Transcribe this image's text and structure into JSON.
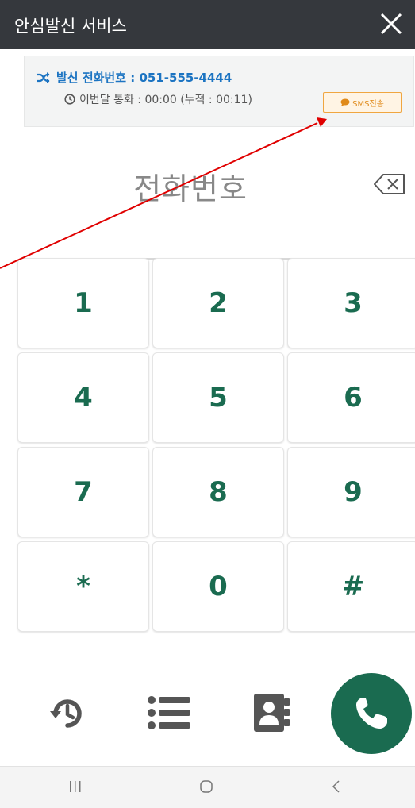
{
  "header": {
    "title": "안심발신 서비스",
    "close_icon": "close-icon"
  },
  "info": {
    "caller_label": "발신 전화번호 : 051-555-4444",
    "usage_label": "이번달 통화 : 00:00 (누적 : 00:11)",
    "sms_button": "SMS전송"
  },
  "dial": {
    "placeholder": "전화번호"
  },
  "keypad": {
    "keys": [
      "1",
      "2",
      "3",
      "4",
      "5",
      "6",
      "7",
      "8",
      "9",
      "*",
      "0",
      "#"
    ]
  },
  "colors": {
    "titlebar": "#35383d",
    "accent_green": "#1a6b50",
    "caller_blue": "#1c74c2",
    "sms_orange": "#f0a640",
    "annotation_red": "#e00000"
  },
  "actions": {
    "recent": "history-icon",
    "list": "list-icon",
    "contacts": "contacts-icon",
    "call": "phone-icon"
  }
}
